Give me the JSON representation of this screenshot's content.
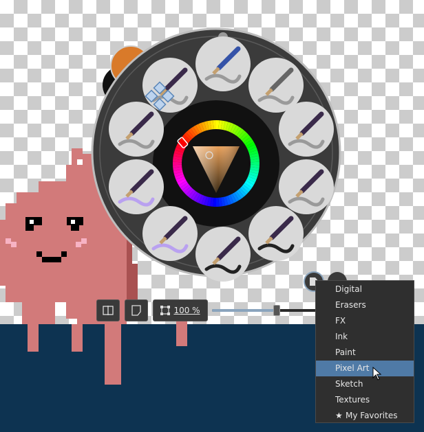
{
  "zoom": {
    "label": "100 %",
    "level_percent": 100,
    "slider_fraction": 0.59
  },
  "colors": {
    "foreground": "#d97a2a",
    "background": "#121212",
    "canvas_fill": "#0d3351",
    "mascot_body": "#d27a7a",
    "mascot_shadow": "#a95151",
    "menu_highlight": "#4f7aa6"
  },
  "brush_presets": [
    {
      "icon": "airbrush-pen-icon"
    },
    {
      "icon": "marker-icon"
    },
    {
      "icon": "eraser-smudge-icon"
    },
    {
      "icon": "airbrush-soft-icon"
    },
    {
      "icon": "paintbrush-gray-icon"
    },
    {
      "icon": "flat-brush-icon"
    },
    {
      "icon": "fan-brush-icon"
    },
    {
      "icon": "watercolor-brush-icon"
    },
    {
      "icon": "wet-round-brush-icon"
    },
    {
      "icon": "water-brush-icon"
    },
    {
      "icon": "transform-move-icon"
    }
  ],
  "tag_menu": {
    "items": [
      {
        "label": "Digital"
      },
      {
        "label": "Erasers"
      },
      {
        "label": "FX"
      },
      {
        "label": "Ink"
      },
      {
        "label": "Paint"
      },
      {
        "label": "Pixel Art",
        "selected": true
      },
      {
        "label": "Sketch"
      },
      {
        "label": "Textures"
      },
      {
        "label": "My Favorites",
        "icon": "star-icon"
      }
    ]
  }
}
